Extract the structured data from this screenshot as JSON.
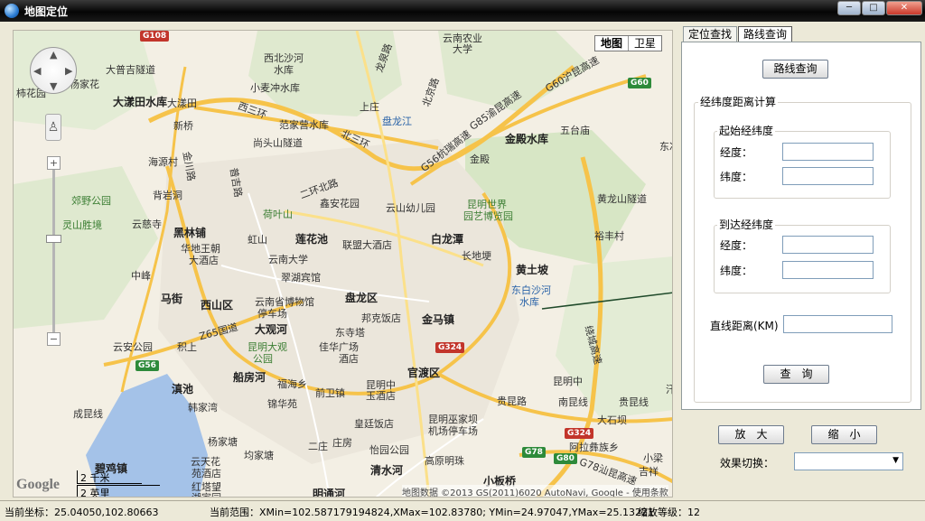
{
  "window": {
    "title": "地图定位",
    "min": "─",
    "max": "□",
    "close": "✕"
  },
  "map": {
    "map_type": {
      "map": "地图",
      "satellite": "卫星"
    },
    "scale": {
      "km": "2 千米",
      "mi": "2 英里"
    },
    "google_logo": "Google",
    "copyright": "地图数据 ©2013 GS(2011)6020 AutoNavi, Google - 使用条款",
    "labels": [
      {
        "t": "西北沙河",
        "c": "green"
      },
      {
        "t": "水库",
        "c": ""
      },
      {
        "t": "小麦冲水库",
        "c": ""
      },
      {
        "t": "大漾田水库",
        "c": "big"
      },
      {
        "t": "大漾田",
        "c": ""
      },
      {
        "t": "范家营水库",
        "c": ""
      },
      {
        "t": "尚头山隧道",
        "c": ""
      },
      {
        "t": "新桥",
        "c": ""
      },
      {
        "t": "海源村",
        "c": ""
      },
      {
        "t": "背岩洞",
        "c": ""
      },
      {
        "t": "郊野公园",
        "c": "green"
      },
      {
        "t": "灵山胜境",
        "c": "green"
      },
      {
        "t": "云慈寺",
        "c": ""
      },
      {
        "t": "黑林铺",
        "c": "big"
      },
      {
        "t": "华地王朝",
        "c": ""
      },
      {
        "t": "大酒店",
        "c": ""
      },
      {
        "t": "中峰",
        "c": ""
      },
      {
        "t": "马街",
        "c": "big"
      },
      {
        "t": "西山区",
        "c": "big"
      },
      {
        "t": "盘龙区",
        "c": "big"
      },
      {
        "t": "大观河",
        "c": "big"
      },
      {
        "t": "官渡区",
        "c": "big"
      },
      {
        "t": "金马镇",
        "c": "big"
      },
      {
        "t": "白龙潭",
        "c": "big"
      },
      {
        "t": "黄土坡",
        "c": "big"
      },
      {
        "t": "长地埂",
        "c": ""
      },
      {
        "t": "金殿水库",
        "c": "big"
      },
      {
        "t": "金殿",
        "c": ""
      },
      {
        "t": "昆明世界",
        "c": "green"
      },
      {
        "t": "园艺博览园",
        "c": "green"
      },
      {
        "t": "云山幼儿园",
        "c": ""
      },
      {
        "t": "鑫安花园",
        "c": ""
      },
      {
        "t": "荷叶山",
        "c": "green"
      },
      {
        "t": "虹山",
        "c": ""
      },
      {
        "t": "莲花池",
        "c": "big"
      },
      {
        "t": "联盟大酒店",
        "c": ""
      },
      {
        "t": "云南大学",
        "c": ""
      },
      {
        "t": "翠湖宾馆",
        "c": ""
      },
      {
        "t": "云南省博物馆",
        "c": ""
      },
      {
        "t": "停车场",
        "c": ""
      },
      {
        "t": "邦克饭店",
        "c": ""
      },
      {
        "t": "东寺塔",
        "c": ""
      },
      {
        "t": "佳华广场",
        "c": ""
      },
      {
        "t": "酒店",
        "c": ""
      },
      {
        "t": "昆明大观",
        "c": "green"
      },
      {
        "t": "公园",
        "c": "green"
      },
      {
        "t": "船房河",
        "c": "big"
      },
      {
        "t": "福海乡",
        "c": ""
      },
      {
        "t": "滇池",
        "c": "big"
      },
      {
        "t": "韩家湾",
        "c": ""
      },
      {
        "t": "锦华苑",
        "c": ""
      },
      {
        "t": "前卫镇",
        "c": ""
      },
      {
        "t": "昆明中",
        "c": ""
      },
      {
        "t": "玉酒店",
        "c": ""
      },
      {
        "t": "皇廷饭店",
        "c": ""
      },
      {
        "t": "杨家塘",
        "c": ""
      },
      {
        "t": "二庄",
        "c": ""
      },
      {
        "t": "庄房",
        "c": ""
      },
      {
        "t": "怡园公园",
        "c": ""
      },
      {
        "t": "均家塘",
        "c": ""
      },
      {
        "t": "云天花",
        "c": ""
      },
      {
        "t": "苑酒店",
        "c": ""
      },
      {
        "t": "红塔望",
        "c": ""
      },
      {
        "t": "湖家园",
        "c": ""
      },
      {
        "t": "明通河",
        "c": "big"
      },
      {
        "t": "清水河",
        "c": "big"
      },
      {
        "t": "昆明巫家坝",
        "c": ""
      },
      {
        "t": "机场停车场",
        "c": ""
      },
      {
        "t": "高原明珠",
        "c": ""
      },
      {
        "t": "小板桥",
        "c": "big"
      },
      {
        "t": "成昆线",
        "c": ""
      },
      {
        "t": "碧鸡镇",
        "c": "big"
      },
      {
        "t": "云安公园",
        "c": ""
      },
      {
        "t": "积上",
        "c": ""
      },
      {
        "t": "上庄",
        "c": ""
      },
      {
        "t": "五台庙",
        "c": ""
      },
      {
        "t": "黄龙山隧道",
        "c": ""
      },
      {
        "t": "裕丰村",
        "c": ""
      },
      {
        "t": "东白沙河",
        "c": "blue"
      },
      {
        "t": "水库",
        "c": "blue"
      },
      {
        "t": "贵昆路",
        "c": ""
      },
      {
        "t": "南昆线",
        "c": ""
      },
      {
        "t": "贵昆线",
        "c": ""
      },
      {
        "t": "大石坝",
        "c": ""
      },
      {
        "t": "阿拉彝族乡",
        "c": ""
      },
      {
        "t": "大普吉隧道",
        "c": ""
      },
      {
        "t": "杨家花",
        "c": ""
      },
      {
        "t": "柿花园",
        "c": ""
      },
      {
        "t": "云南农业",
        "c": ""
      },
      {
        "t": "大学",
        "c": ""
      },
      {
        "t": "盘龙江",
        "c": "blue"
      },
      {
        "t": "东冲",
        "c": ""
      },
      {
        "t": "昆明中",
        "c": ""
      },
      {
        "t": "汗家冲",
        "c": ""
      },
      {
        "t": "小梁",
        "c": ""
      },
      {
        "t": "吉祥",
        "c": ""
      }
    ],
    "shields": [
      {
        "t": "G108",
        "c": "red"
      },
      {
        "t": "G60",
        "c": "green"
      },
      {
        "t": "G56",
        "c": "green"
      },
      {
        "t": "G324",
        "c": "red"
      },
      {
        "t": "G78",
        "c": "green"
      },
      {
        "t": "G80",
        "c": "green"
      },
      {
        "t": "G324",
        "c": "red"
      }
    ],
    "road_labels": [
      {
        "t": "西三环"
      },
      {
        "t": "北三环"
      },
      {
        "t": "二环北路"
      },
      {
        "t": "G56杭瑞高速"
      },
      {
        "t": "G85渝昆高速"
      },
      {
        "t": "G60沪昆高速"
      },
      {
        "t": "Z65国道"
      },
      {
        "t": "G78汕昆高速"
      },
      {
        "t": "龙泉路"
      },
      {
        "t": "北京路"
      },
      {
        "t": "绕城高速"
      },
      {
        "t": "普吉路"
      },
      {
        "t": "金川路"
      }
    ]
  },
  "tabs": {
    "locate": "定位查找",
    "route": "路线查询"
  },
  "route_panel": {
    "route_button": "路线查询",
    "distance_group": "经纬度距离计算",
    "start_group": "起始经纬度",
    "end_group": "到达经纬度",
    "lon_label": "经度：",
    "lat_label": "纬度：",
    "distance_label": "直线距离(KM)",
    "query_button": "查　询",
    "start_lon": "",
    "start_lat": "",
    "end_lon": "",
    "end_lat": "",
    "distance": ""
  },
  "controls": {
    "zoom_in": "放　大",
    "zoom_out": "缩　小",
    "effect_label": "效果切换：",
    "effect_value": "",
    "effect_arrow": "▼"
  },
  "status": {
    "coord": "当前坐标：25.04050,102.80663",
    "range": "当前范围：XMin=102.587179194824,XMax=102.83780; YMin=24.97047,YMax=25.13221",
    "zoom": "缩放等级：12"
  }
}
